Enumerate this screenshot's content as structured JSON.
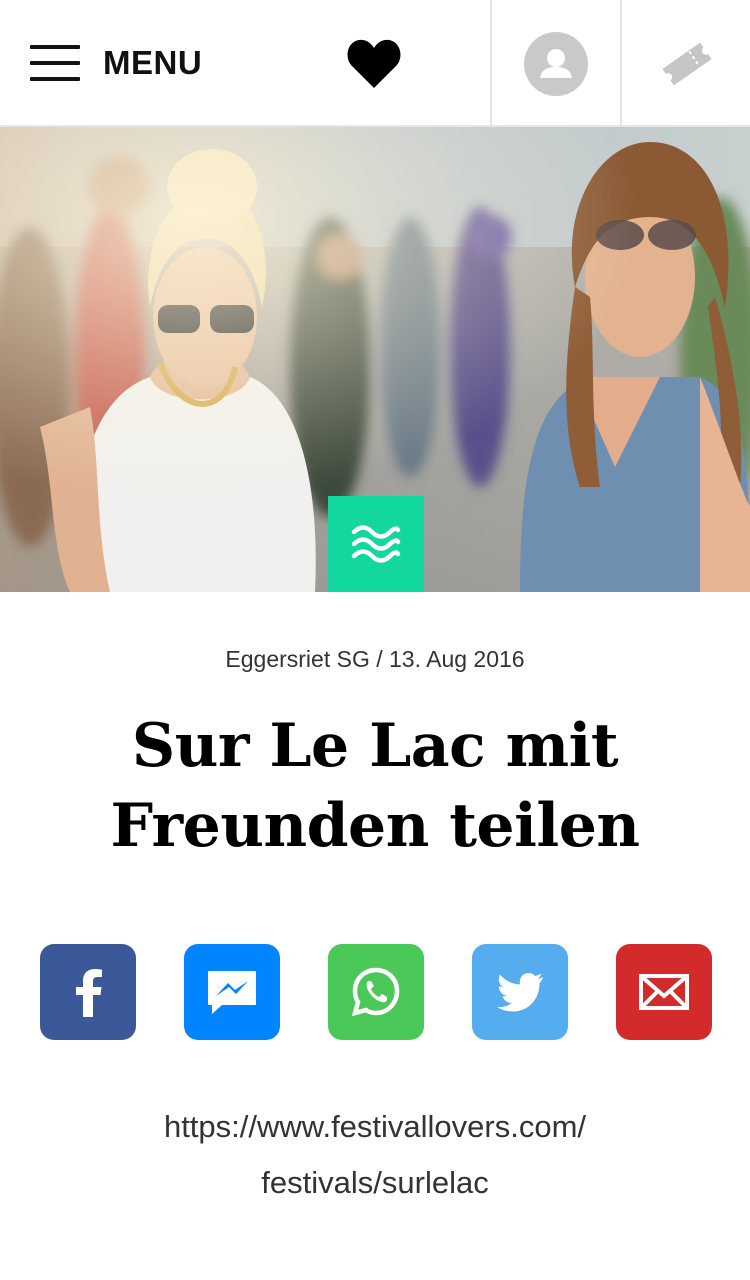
{
  "header": {
    "menu_label": "MENU"
  },
  "hero": {
    "category_icon": "waves-icon",
    "badge_color": "#12d8a0"
  },
  "event": {
    "meta": "Eggersriet SG / 13. Aug 2016",
    "title_line1": "Sur Le Lac mit",
    "title_line2": "Freunden teilen"
  },
  "share": {
    "buttons": [
      {
        "name": "facebook",
        "icon": "facebook-icon",
        "color": "#3b5998"
      },
      {
        "name": "messenger",
        "icon": "messenger-icon",
        "color": "#0084ff"
      },
      {
        "name": "whatsapp",
        "icon": "whatsapp-icon",
        "color": "#4ac959"
      },
      {
        "name": "twitter",
        "icon": "twitter-icon",
        "color": "#55acee"
      },
      {
        "name": "email",
        "icon": "mail-icon",
        "color": "#d32b2b"
      }
    ],
    "url_line1": "https://www.festivallovers.com/",
    "url_line2": "festivals/surlelac"
  }
}
